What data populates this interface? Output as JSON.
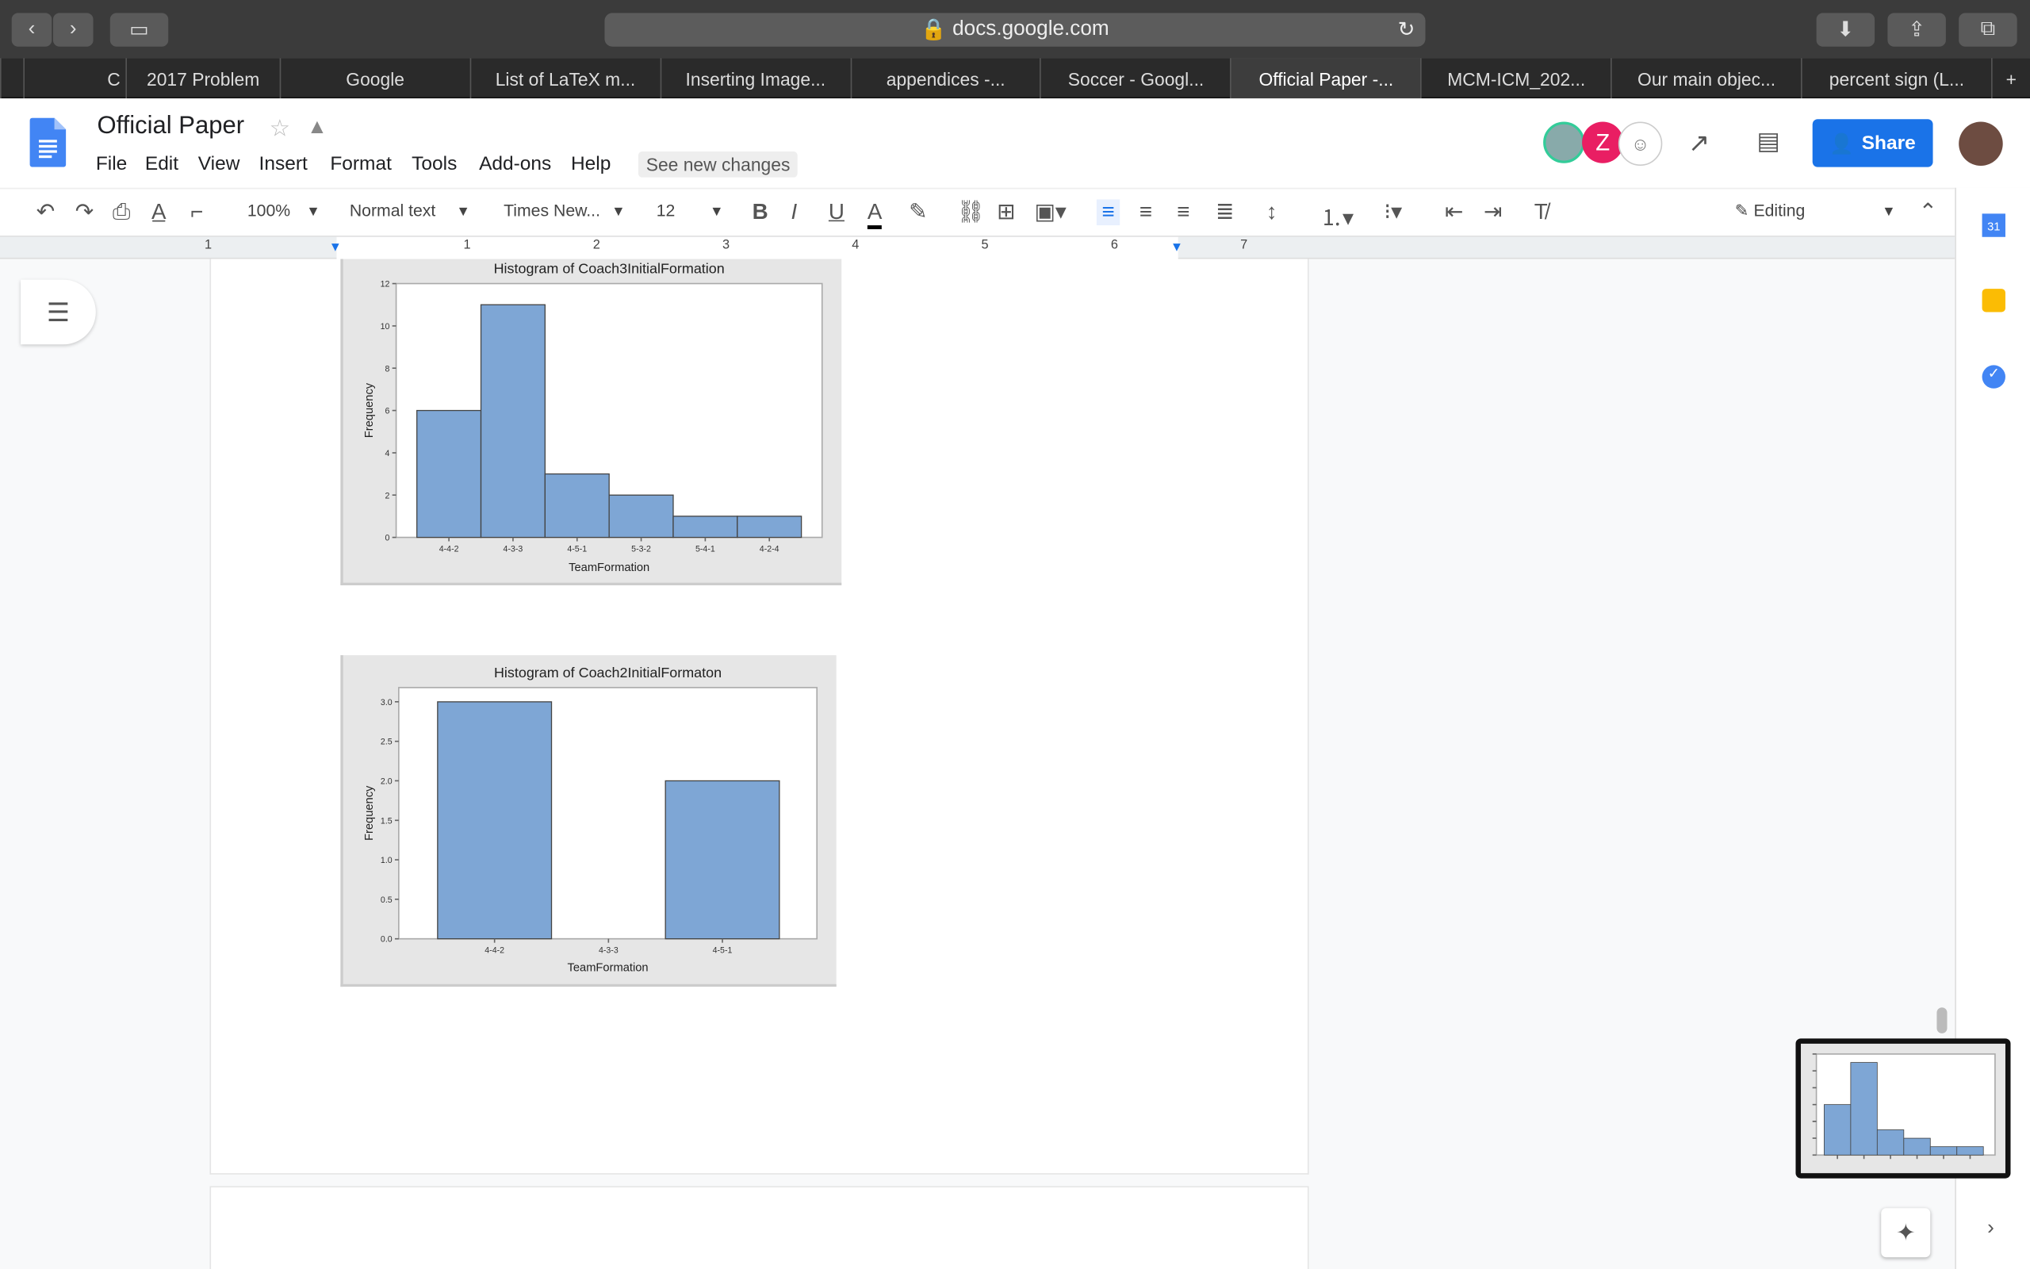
{
  "browser": {
    "url": "docs.google.com",
    "tabs": [
      "",
      "C",
      "2017 Problem",
      "Google",
      "List of LaTeX m...",
      "Inserting Image...",
      "appendices -...",
      "Soccer - Googl...",
      "Official Paper -...",
      "MCM-ICM_202...",
      "Our main objec...",
      "percent sign (L..."
    ],
    "active_tab": 8
  },
  "docs": {
    "title": "Official Paper",
    "menu": [
      "File",
      "Edit",
      "View",
      "Insert",
      "Format",
      "Tools",
      "Add-ons",
      "Help"
    ],
    "see_changes": "See new changes",
    "share": "Share",
    "avatar_letter": "Z"
  },
  "toolbar": {
    "zoom": "100%",
    "style": "Normal text",
    "font": "Times New...",
    "size": "12",
    "mode": "Editing"
  },
  "ruler": [
    "1",
    "1",
    "2",
    "3",
    "4",
    "5",
    "6",
    "7"
  ],
  "sidepanel": {
    "calendar": "31"
  },
  "colors": {
    "bar": "#7ea6d5",
    "accent": "#1a73e8"
  },
  "chart_data": [
    {
      "type": "bar",
      "title": "Histogram of Coach3InitialFormation",
      "xlabel": "TeamFormation",
      "ylabel": "Frequency",
      "categories": [
        "4-4-2",
        "4-3-3",
        "4-5-1",
        "5-3-2",
        "5-4-1",
        "4-2-4"
      ],
      "values": [
        6,
        11,
        3,
        2,
        1,
        1
      ],
      "ylim": [
        0,
        12
      ],
      "yticks": [
        "0",
        "2",
        "4",
        "6",
        "8",
        "10",
        "12"
      ],
      "grid": false
    },
    {
      "type": "bar",
      "title": "Histogram of Coach2InitialFormaton",
      "xlabel": "TeamFormation",
      "ylabel": "Frequency",
      "categories": [
        "4-4-2",
        "4-3-3",
        "4-5-1"
      ],
      "values": [
        3,
        0,
        2
      ],
      "ylim": [
        0,
        3.18
      ],
      "yticks": [
        "0.0",
        "0.5",
        "1.0",
        "1.5",
        "2.0",
        "2.5",
        "3.0"
      ],
      "grid": false
    }
  ]
}
